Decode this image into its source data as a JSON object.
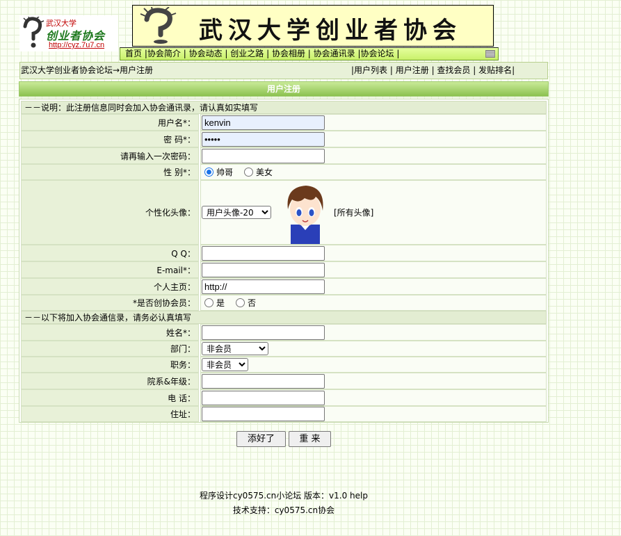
{
  "logo": {
    "line1": "武汉大学",
    "line2": "创业者协会",
    "url": "http://cyz.7u7.cn"
  },
  "banner": {
    "title": "武汉大学创业者协会"
  },
  "nav": [
    "首页",
    "|协会简介",
    "| 协会动态",
    "| 创业之路",
    "| 协会相册",
    "| 协会通讯录",
    "|协会论坛",
    "|"
  ],
  "breadcrumb": "武汉大学创业者协会论坛→用户注册",
  "top_links": [
    "|用户列表",
    "| 用户注册",
    "| 查找会员",
    "| 发贴排名|"
  ],
  "section_title": "用户注册",
  "notes": {
    "first": "－－说明：此注册信息同时会加入协会通讯录，请认真如实填写",
    "second": "－－以下将加入协会通信录，请务必认真填写"
  },
  "fields": {
    "username": {
      "label": "用户名*：",
      "value": "kenvin"
    },
    "password": {
      "label": "密 码*：",
      "value": "•••••"
    },
    "password2": {
      "label": "请再输入一次密码：",
      "value": ""
    },
    "gender": {
      "label": "性 别*：",
      "options": [
        "帅哥",
        "美女"
      ],
      "selected": "帅哥"
    },
    "avatar": {
      "label": "个性化头像：",
      "selected": "用户头像-20",
      "all_link": "[所有头像]"
    },
    "qq": {
      "label": "Q Q：",
      "value": ""
    },
    "email": {
      "label": "E-mail*：",
      "value": ""
    },
    "homepage": {
      "label": "个人主页：",
      "value": "http://"
    },
    "member": {
      "label": "*是否创协会员：",
      "options": [
        "是",
        "否"
      ]
    },
    "name": {
      "label": "姓名*：",
      "value": ""
    },
    "department": {
      "label": "部门：",
      "selected": "非会员"
    },
    "position": {
      "label": "职务：",
      "selected": "非会员"
    },
    "school": {
      "label": "院系&年级：",
      "value": ""
    },
    "phone": {
      "label": "电 话：",
      "value": ""
    },
    "address": {
      "label": "住址：",
      "value": ""
    }
  },
  "buttons": {
    "submit": "添好了",
    "reset": "重 来"
  },
  "footer": {
    "line1": "程序设计cy0575.cn小论坛 版本：v1.0 help",
    "line2": "技术支持：cy0575.cn协会"
  }
}
